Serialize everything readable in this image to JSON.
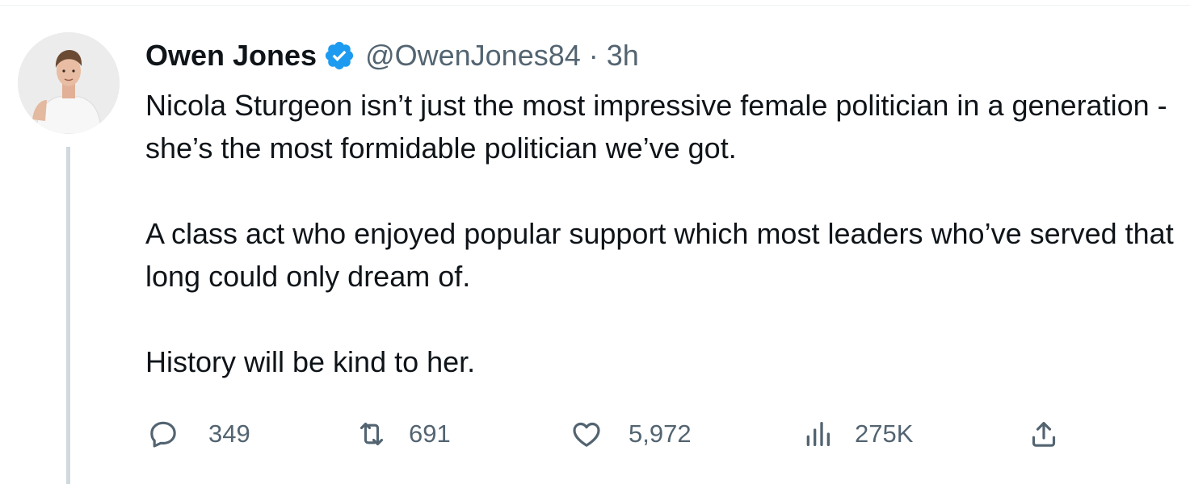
{
  "tweet": {
    "author": {
      "display_name": "Owen Jones",
      "handle": "@OwenJones84",
      "verified": true
    },
    "separator": "·",
    "time": "3h",
    "paragraphs": [
      "Nicola Sturgeon isn’t just the most impressive female politician in a generation - she’s the most formidable politician we’ve got.",
      "A class act who enjoyed popular support which most leaders who’ve served that long could only dream of.",
      "History will be kind to her."
    ],
    "actions": {
      "reply": {
        "icon": "reply-icon",
        "count": "349"
      },
      "retweet": {
        "icon": "retweet-icon",
        "count": "691"
      },
      "like": {
        "icon": "heart-icon",
        "count": "5,972"
      },
      "views": {
        "icon": "views-chart-icon",
        "count": "275K"
      },
      "share": {
        "icon": "share-icon"
      }
    }
  },
  "colors": {
    "text": "#0f1419",
    "secondary": "#536471",
    "verified": "#1d9bf0",
    "thread_line": "#cfd9de"
  }
}
